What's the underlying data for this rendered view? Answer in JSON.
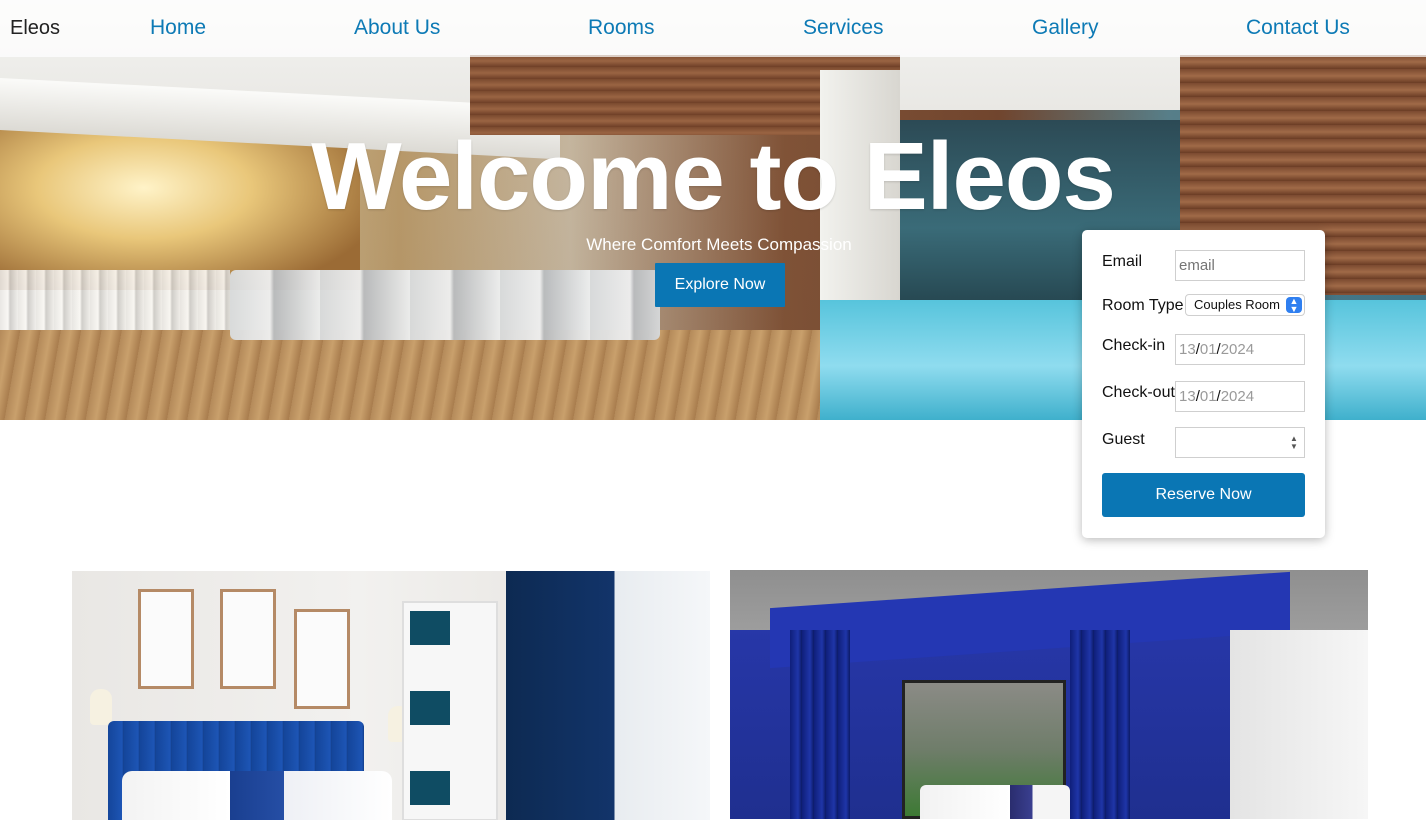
{
  "nav": {
    "brand": "Eleos",
    "links": [
      "Home",
      "About Us",
      "Rooms",
      "Services",
      "Gallery",
      "Contact Us"
    ],
    "link_color": "#0d7ab5"
  },
  "hero": {
    "title": "Welcome to Eleos",
    "subtitle": "Where Comfort Meets Compassion",
    "cta": "Explore Now"
  },
  "booking": {
    "email_label": "Email",
    "email_placeholder": "email",
    "room_type_label": "Room Type",
    "room_type_selected": "Couples Room",
    "checkin_label": "Check-in",
    "checkin_value": {
      "day": "13",
      "month": "01",
      "year": "2024"
    },
    "checkout_label": "Check-out",
    "checkout_value": {
      "day": "13",
      "month": "01",
      "year": "2024"
    },
    "guest_label": "Guest",
    "guest_value": "",
    "reserve_label": "Reserve Now",
    "accent": "#0a76b4"
  }
}
